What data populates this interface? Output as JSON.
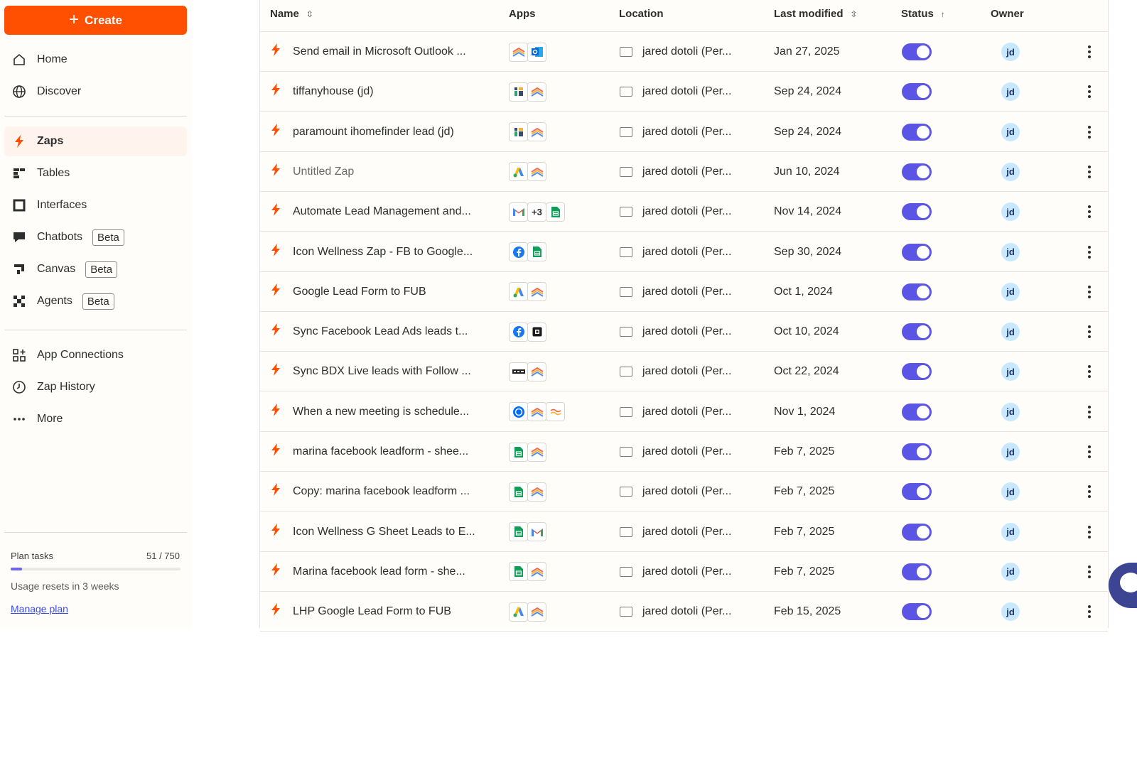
{
  "sidebar": {
    "create_label": "Create",
    "nav": [
      {
        "label": "Home",
        "icon": "home-icon"
      },
      {
        "label": "Discover",
        "icon": "globe-icon"
      },
      {
        "label": "Zaps",
        "icon": "bolt-icon",
        "active": true
      },
      {
        "label": "Tables",
        "icon": "tables-icon"
      },
      {
        "label": "Interfaces",
        "icon": "interfaces-icon"
      },
      {
        "label": "Chatbots",
        "icon": "chatbot-icon",
        "badge": "Beta"
      },
      {
        "label": "Canvas",
        "icon": "canvas-icon",
        "badge": "Beta"
      },
      {
        "label": "Agents",
        "icon": "agents-icon",
        "badge": "Beta"
      },
      {
        "label": "App Connections",
        "icon": "app-connections-icon"
      },
      {
        "label": "Zap History",
        "icon": "history-icon"
      },
      {
        "label": "More",
        "icon": "more-icon"
      }
    ],
    "plan": {
      "label": "Plan tasks",
      "count": "51 / 750",
      "used_fraction": 0.068,
      "reset": "Usage resets in 3 weeks",
      "manage": "Manage plan"
    }
  },
  "table": {
    "headers": {
      "name": "Name",
      "apps": "Apps",
      "location": "Location",
      "modified": "Last modified",
      "status": "Status",
      "owner": "Owner"
    },
    "rows": [
      {
        "name": "Send email in Microsoft Outlook ...",
        "apps": [
          "layers",
          "outlook"
        ],
        "location": "jared dotoli (Per...",
        "modified": "Jan 27, 2025",
        "owner": "jd"
      },
      {
        "name": "tiffanyhouse (jd)",
        "apps": [
          "bars",
          "layers"
        ],
        "location": "jared dotoli (Per...",
        "modified": "Sep 24, 2024",
        "owner": "jd"
      },
      {
        "name": "paramount ihomefinder lead (jd)",
        "apps": [
          "bars",
          "layers"
        ],
        "location": "jared dotoli (Per...",
        "modified": "Sep 24, 2024",
        "owner": "jd"
      },
      {
        "name": "Untitled Zap",
        "apps": [
          "google-ads",
          "layers"
        ],
        "location": "jared dotoli (Per...",
        "modified": "Jun 10, 2024",
        "owner": "jd",
        "muted": true
      },
      {
        "name": "Automate Lead Management and...",
        "apps": [
          "gmail",
          "+3",
          "sheets"
        ],
        "location": "jared dotoli (Per...",
        "modified": "Nov 14, 2024",
        "owner": "jd"
      },
      {
        "name": "Icon Wellness Zap - FB to Google...",
        "apps": [
          "facebook",
          "sheets"
        ],
        "location": "jared dotoli (Per...",
        "modified": "Sep 30, 2024",
        "owner": "jd"
      },
      {
        "name": "Google Lead Form to FUB",
        "apps": [
          "google-ads",
          "layers"
        ],
        "location": "jared dotoli (Per...",
        "modified": "Oct 1, 2024",
        "owner": "jd"
      },
      {
        "name": "Sync Facebook Lead Ads leads t...",
        "apps": [
          "facebook",
          "square"
        ],
        "location": "jared dotoli (Per...",
        "modified": "Oct 10, 2024",
        "owner": "jd"
      },
      {
        "name": "Sync BDX Live leads with Follow ...",
        "apps": [
          "bdx",
          "layers"
        ],
        "location": "jared dotoli (Per...",
        "modified": "Oct 22, 2024",
        "owner": "jd"
      },
      {
        "name": "When a new meeting is schedule...",
        "apps": [
          "calendly",
          "layers",
          "wave"
        ],
        "location": "jared dotoli (Per...",
        "modified": "Nov 1, 2024",
        "owner": "jd"
      },
      {
        "name": "marina facebook leadform - shee...",
        "apps": [
          "sheets",
          "layers"
        ],
        "location": "jared dotoli (Per...",
        "modified": "Feb 7, 2025",
        "owner": "jd"
      },
      {
        "name": "Copy: marina facebook leadform ...",
        "apps": [
          "sheets",
          "layers"
        ],
        "location": "jared dotoli (Per...",
        "modified": "Feb 7, 2025",
        "owner": "jd"
      },
      {
        "name": "Icon Wellness G Sheet Leads to E...",
        "apps": [
          "sheets",
          "gmail"
        ],
        "location": "jared dotoli (Per...",
        "modified": "Feb 7, 2025",
        "owner": "jd"
      },
      {
        "name": "Marina facebook lead form - she...",
        "apps": [
          "sheets",
          "layers"
        ],
        "location": "jared dotoli (Per...",
        "modified": "Feb 7, 2025",
        "owner": "jd"
      },
      {
        "name": "LHP Google Lead Form to FUB",
        "apps": [
          "google-ads",
          "layers"
        ],
        "location": "jared dotoli (Per...",
        "modified": "Feb 15, 2025",
        "owner": "jd"
      }
    ]
  },
  "colors": {
    "accent": "#ff4f00",
    "toggle_on": "#5b55e6",
    "avatar_bg": "#c7e8ff"
  }
}
